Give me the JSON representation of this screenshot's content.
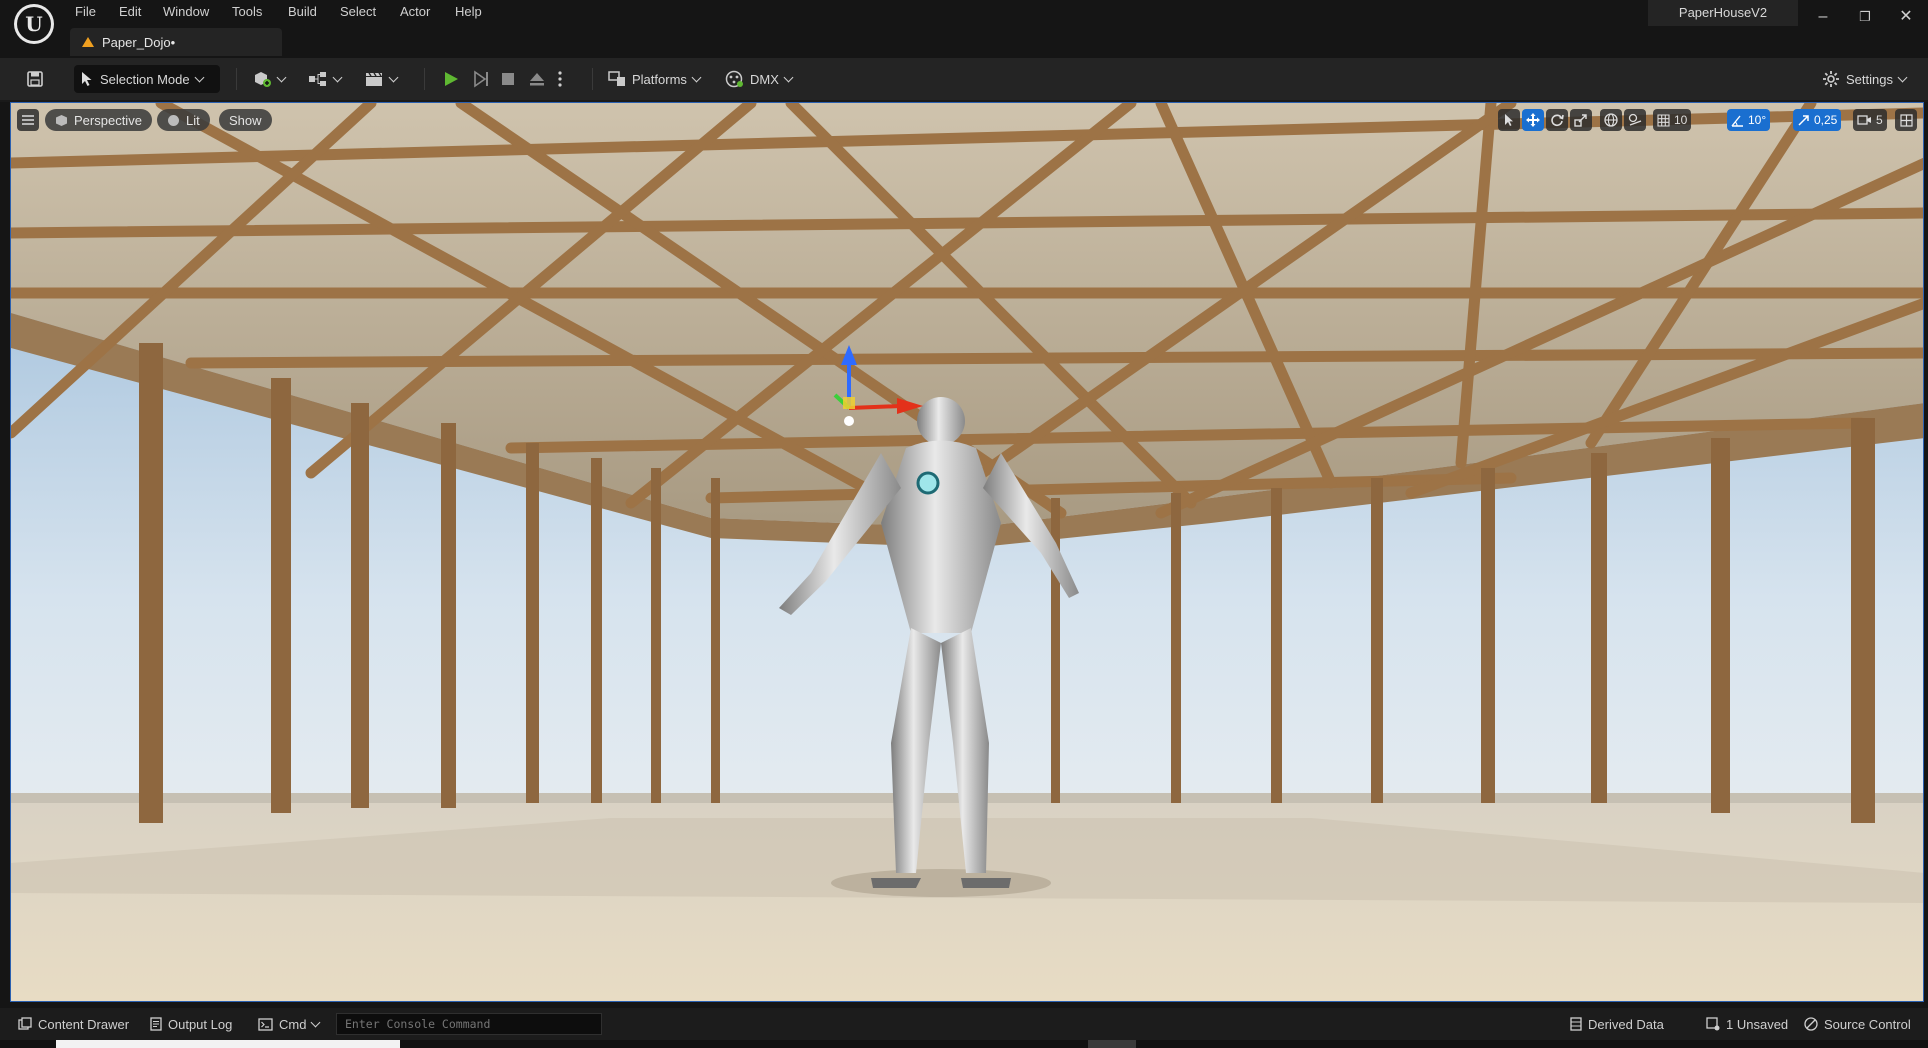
{
  "menu": [
    "File",
    "Edit",
    "Window",
    "Tools",
    "Build",
    "Select",
    "Actor",
    "Help"
  ],
  "project_name": "PaperHouseV2",
  "level_tab": "Paper_Dojo•",
  "window_controls": [
    "–",
    "❐",
    "✕"
  ],
  "toolbar": {
    "selection_mode": "Selection Mode",
    "platforms": "Platforms",
    "dmx": "DMX",
    "settings": "Settings"
  },
  "viewport": {
    "perspective": "Perspective",
    "lit": "Lit",
    "show": "Show",
    "grid_snap": "10",
    "rotation_snap": "10°",
    "scale_snap": "0,25",
    "camera_speed": "5"
  },
  "statusbar": {
    "content_drawer": "Content Drawer",
    "output_log": "Output Log",
    "cmd": "Cmd",
    "console_placeholder": "Enter Console Command",
    "derived_data": "Derived Data",
    "unsaved": "1 Unsaved",
    "source_control": "Source Control"
  },
  "colors": {
    "accent": "#1a6fd0",
    "play": "#5fb832",
    "level_icon": "#f0a020"
  }
}
